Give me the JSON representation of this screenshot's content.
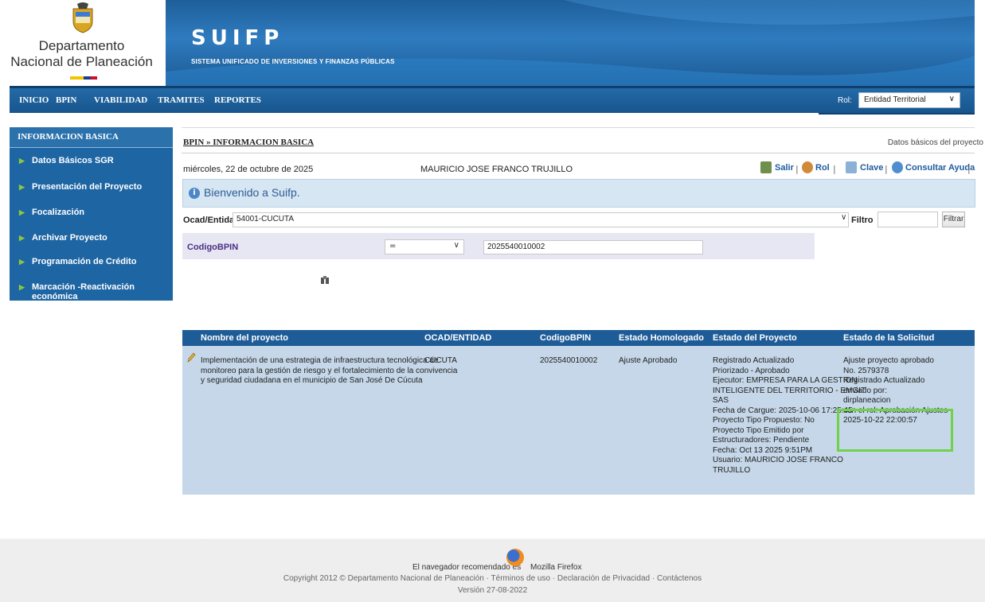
{
  "header": {
    "org_line1": "Departamento",
    "org_line2": "Nacional de Planeación",
    "app_title": "SUIFP",
    "app_subtitle": "SISTEMA UNIFICADO DE INVERSIONES Y FINANZAS PÚBLICAS"
  },
  "nav": {
    "items": [
      "INICIO",
      "BPIN",
      "VIABILIDAD",
      "TRAMITES",
      "REPORTES"
    ],
    "rol_label": "Rol:",
    "rol_value": "Entidad Territorial"
  },
  "sidebar": {
    "title": "INFORMACION BASICA",
    "items": [
      {
        "label": "Datos Básicos SGR"
      },
      {
        "label": "Presentación del Proyecto"
      },
      {
        "label": "Focalización"
      },
      {
        "label": "Archivar Proyecto"
      },
      {
        "label": "Programación de Crédito"
      },
      {
        "label": "Marcación -Reactivación económica"
      }
    ]
  },
  "breadcrumb": "BPIN » INFORMACION BASICA",
  "page_caption": "Datos básicos del proyecto",
  "date": "miércoles, 22 de octubre de 2025",
  "user": "MAURICIO JOSE FRANCO TRUJILLO",
  "toplinks": {
    "salir": "Salir",
    "rol": "Rol",
    "clave": "Clave",
    "ayuda": "Consultar Ayuda",
    "sep": "|"
  },
  "welcome": "Bienvenido a Suifp.",
  "filter": {
    "ocad_label": "Ocad/Entidad",
    "ocad_value": "54001-CUCUTA",
    "filtro_label": "Filtro",
    "filtro_value": "",
    "filtrar_button": "Filtrar"
  },
  "criteria": {
    "field": "CodigoBPIN",
    "operator": "=",
    "value": "2025540010002"
  },
  "table": {
    "headers": [
      "Nombre del proyecto",
      "OCAD/ENTIDAD",
      "CodigoBPIN",
      "Estado Homologado",
      "Estado del Proyecto",
      "Estado de la Solicitud"
    ],
    "row": {
      "nombre": [
        "Implementación de una estrategia de infraestructura tecnológica de",
        "monitoreo para la gestión de riesgo y el fortalecimiento de la convivencia",
        "y seguridad ciudadana en el municipio de San José De Cúcuta"
      ],
      "ocad": "CUCUTA",
      "bpin": "2025540010002",
      "estado_homologado": "Ajuste Aprobado",
      "estado_proyecto": [
        "Registrado Actualizado",
        "Priorizado - Aprobado",
        "Ejecutor: EMPRESA PARA LA GESTION",
        "INTELIGENTE DEL TERRITORIO - EMGIT",
        "SAS",
        "Fecha de Cargue: 2025-10-06 17:25:45",
        "Proyecto Tipo Propuesto: No",
        "Proyecto Tipo Emitido por",
        "Estructuradores: Pendiente",
        "Fecha: Oct 13 2025 9:51PM",
        "Usuario: MAURICIO JOSE FRANCO",
        "TRUJILLO"
      ],
      "estado_solicitud": [
        "Ajuste proyecto aprobado",
        "No. 2579378",
        "Registrado Actualizado",
        "enviado por:",
        "dirplaneacion",
        "con el rol: Aprobación Ajustes",
        "2025-10-22 22:00:57"
      ]
    }
  },
  "footer": {
    "browser_rec": "El navegador recomendado es",
    "browser_name": "Mozilla Firefox",
    "copyright": "Copyright 2012 © Departamento Nacional de Planeación · Términos de uso · Declaración de Privacidad · Contáctenos",
    "version": "Versión 27-08-2022"
  },
  "colors": {
    "nav": "#1e5c98",
    "table_body": "#c5d7e8",
    "highlight": "#6fd24a",
    "link": "#1e5ca0"
  }
}
